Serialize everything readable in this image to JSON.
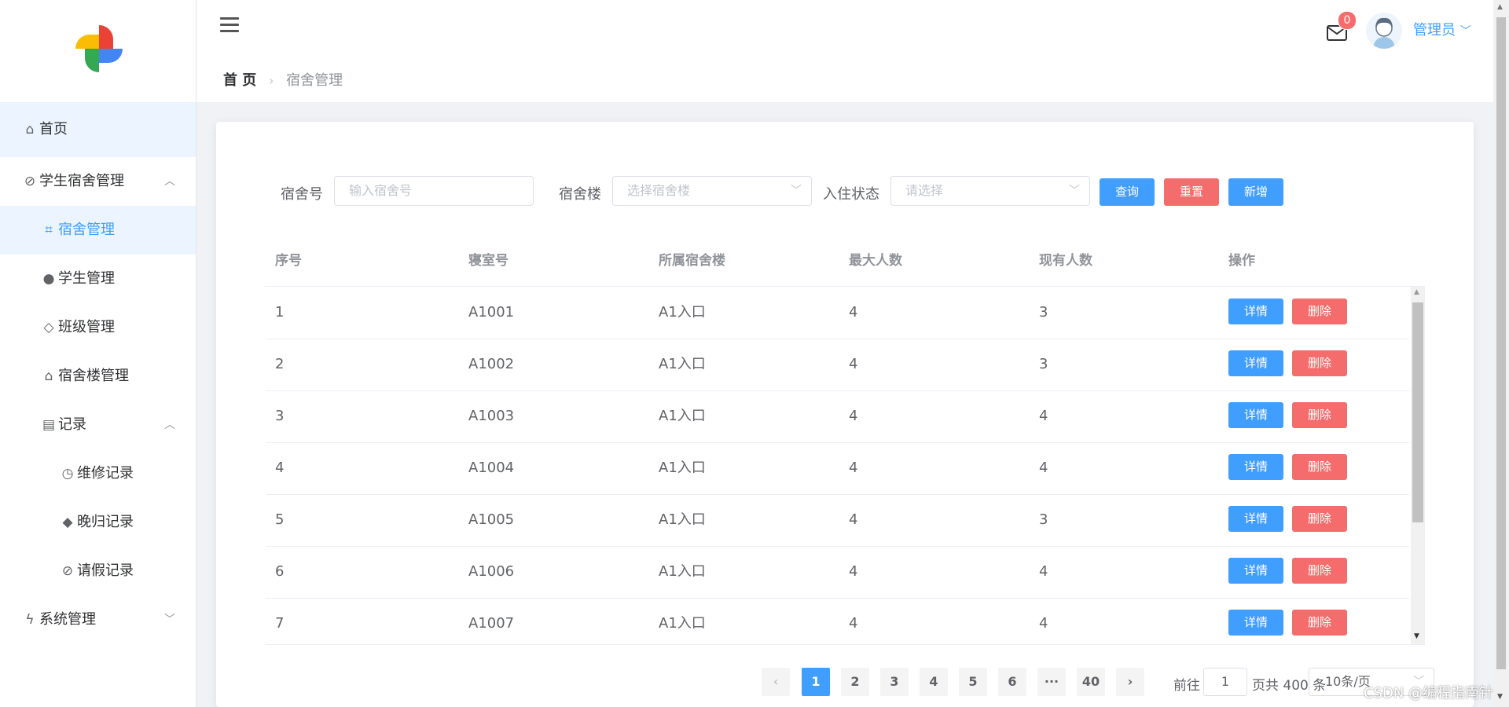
{
  "sidebar": {
    "items": [
      {
        "label": "首页",
        "icon": "home-icon"
      },
      {
        "label": "学生宿舍管理",
        "icon": "paperclip-icon",
        "expanded": true
      },
      {
        "label": "宿舍管理",
        "icon": "crop-icon",
        "active": true
      },
      {
        "label": "学生管理",
        "icon": "user-icon"
      },
      {
        "label": "班级管理",
        "icon": "layers-icon"
      },
      {
        "label": "宿舍楼管理",
        "icon": "house-icon"
      },
      {
        "label": "记录",
        "icon": "clipboard-icon",
        "expanded": true
      },
      {
        "label": "维修记录",
        "icon": "alarm-clock-icon"
      },
      {
        "label": "晚归记录",
        "icon": "tag-icon"
      },
      {
        "label": "请假记录",
        "icon": "paperclip-icon"
      },
      {
        "label": "系统管理",
        "icon": "lightning-icon",
        "expanded": false
      }
    ]
  },
  "header": {
    "breadcrumb": {
      "home": "首 页",
      "current": "宿舍管理"
    },
    "mail_badge": "0",
    "user_name": "管理员"
  },
  "filters": {
    "dorm_no": {
      "label": "宿舍号",
      "placeholder": "输入宿舍号"
    },
    "building": {
      "label": "宿舍楼",
      "placeholder": "选择宿舍楼"
    },
    "status": {
      "label": "入住状态",
      "placeholder": "请选择"
    },
    "buttons": {
      "search": "查询",
      "reset": "重置",
      "add": "新增"
    }
  },
  "table": {
    "columns": [
      "序号",
      "寝室号",
      "所属宿舍楼",
      "最大人数",
      "现有人数",
      "操作"
    ],
    "rows": [
      [
        "1",
        "A1001",
        "A1入口",
        "4",
        "3"
      ],
      [
        "2",
        "A1002",
        "A1入口",
        "4",
        "3"
      ],
      [
        "3",
        "A1003",
        "A1入口",
        "4",
        "4"
      ],
      [
        "4",
        "A1004",
        "A1入口",
        "4",
        "4"
      ],
      [
        "5",
        "A1005",
        "A1入口",
        "4",
        "3"
      ],
      [
        "6",
        "A1006",
        "A1入口",
        "4",
        "4"
      ],
      [
        "7",
        "A1007",
        "A1入口",
        "4",
        "4"
      ]
    ],
    "actions": {
      "detail": "详情",
      "delete": "删除"
    }
  },
  "pagination": {
    "prev": "‹",
    "pages": [
      "1",
      "2",
      "3",
      "4",
      "5",
      "6"
    ],
    "ellipsis": "···",
    "last": "40",
    "next": "›",
    "current": "1",
    "goto_label": "前往",
    "goto_value": "1",
    "total_label": "页共 400 条",
    "page_size": "10条/页"
  },
  "watermark": "CSDN @编程指南针",
  "colors": {
    "primary": "#409eff",
    "danger": "#f56c6c",
    "active_bg": "#ecf5ff"
  }
}
